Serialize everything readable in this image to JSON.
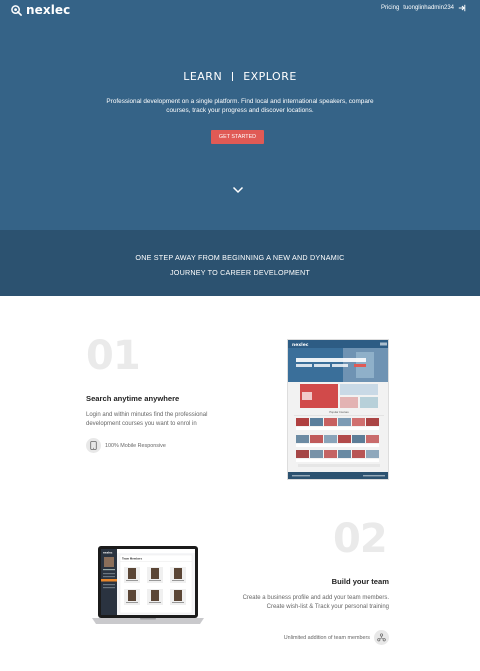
{
  "brand": {
    "name": "nexlec"
  },
  "nav": {
    "pricing": "Pricing",
    "username": "tuonglinhadmin234"
  },
  "hero": {
    "title_left": "LEARN",
    "title_right": "EXPLORE",
    "description": "Professional development on a single platform. Find local and international speakers, compare courses, track your progress and discover locations.",
    "cta": "GET STARTED"
  },
  "band": {
    "line1": "ONE STEP AWAY FROM BEGINNING A NEW AND DYNAMIC",
    "line2": "JOURNEY TO CAREER DEVELOPMENT"
  },
  "features": [
    {
      "number": "01",
      "title": "Search anytime anywhere",
      "description": "Login and within minutes find the professional development courses you want to enrol in",
      "badge": "100% Mobile Responsive",
      "badge_icon": "mobile-phone-icon"
    },
    {
      "number": "02",
      "title": "Build your team",
      "description_line1": "Create a business profile and add your team members.",
      "description_line2": "Create wish-list & Track your personal training",
      "badge": "Unlimited addition of team members",
      "badge_icon": "team-network-icon"
    }
  ],
  "mockups": {
    "site_logo": "nexlec",
    "site_heading": "Popular Courses",
    "app_logo": "nexlec",
    "app_heading": "Team Members"
  },
  "colors": {
    "hero_bg": "#356387",
    "band_bg": "#2c5270",
    "cta_bg": "#e05a55",
    "number_text": "#eaeaea"
  }
}
